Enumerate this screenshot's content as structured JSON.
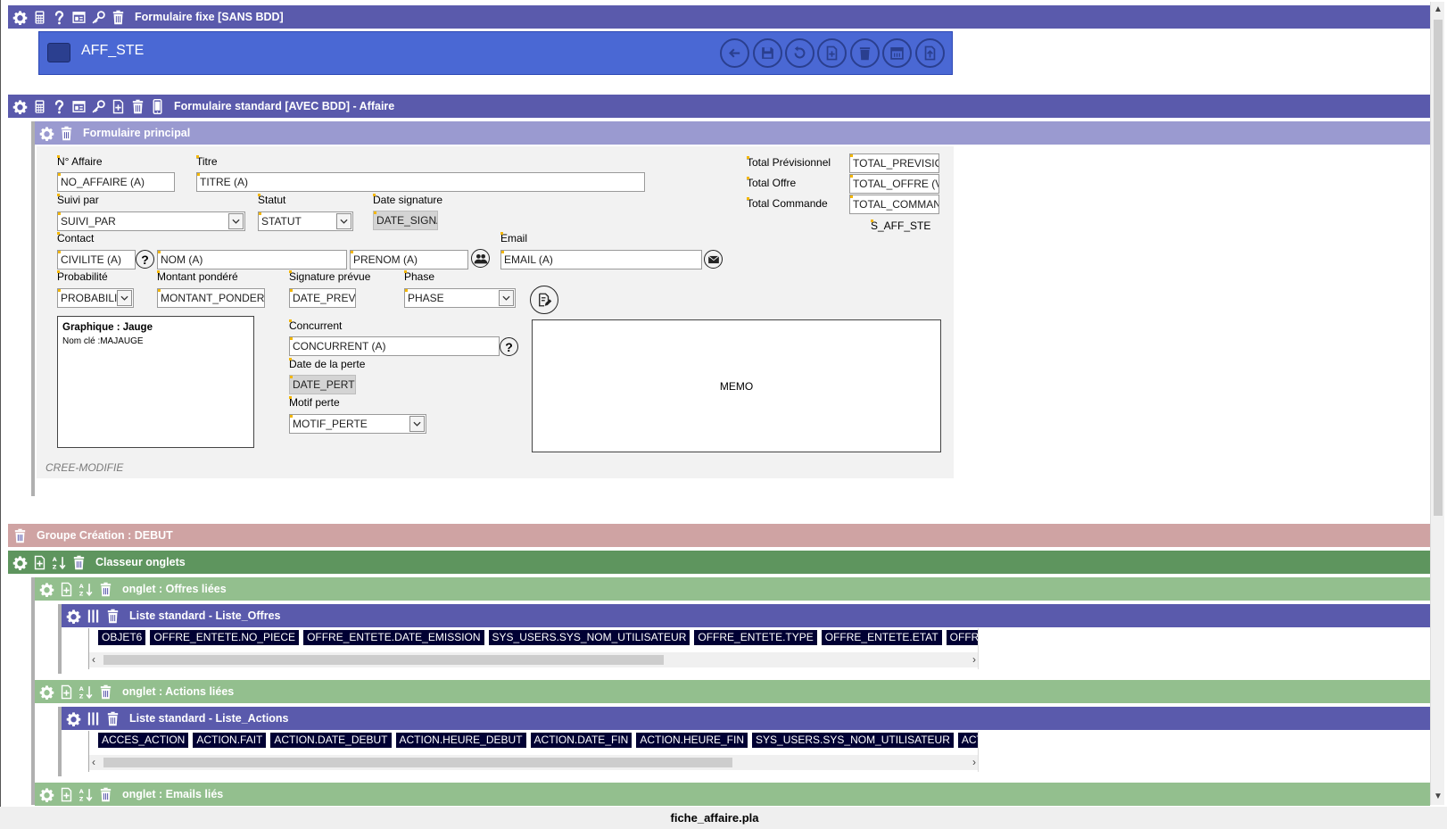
{
  "footer": {
    "filename": "fiche_affaire.pla"
  },
  "fixed_form": {
    "title": "Formulaire fixe [SANS BDD]",
    "name": "AFF_STE",
    "toolbar_icons": [
      "back-arrow-icon",
      "save-icon",
      "undo-icon",
      "new-document-icon",
      "delete-icon",
      "calendar-icon",
      "export-icon"
    ]
  },
  "standard_form": {
    "title": "Formulaire standard [AVEC BDD] - Affaire"
  },
  "main_form": {
    "title": "Formulaire principal",
    "labels": {
      "no_affaire": "N° Affaire",
      "titre": "Titre",
      "suivi_par": "Suivi par",
      "statut": "Statut",
      "date_signature": "Date signature",
      "contact": "Contact",
      "email": "Email",
      "probabilite": "Probabilité",
      "montant_pondere": "Montant pondéré",
      "signature_prevue": "Signature prévue",
      "phase": "Phase",
      "concurrent": "Concurrent",
      "date_perte": "Date de la perte",
      "motif_perte": "Motif perte",
      "total_previsionnel": "Total Prévisionnel",
      "total_offre": "Total Offre",
      "total_commande": "Total Commande"
    },
    "fields": {
      "no_affaire": "NO_AFFAIRE (A)",
      "titre": "TITRE (A)",
      "suivi_par": "SUIVI_PAR",
      "statut": "STATUT",
      "date_signature": "DATE_SIGNA",
      "civilite": "CIVILITE (A)",
      "nom": "NOM (A)",
      "prenom": "PRENOM (A)",
      "email": "EMAIL (A)",
      "probabilite": "PROBABILIT",
      "montant_pondere": "MONTANT_PONDER",
      "signature_prevue": "DATE_PREVI",
      "phase": "PHASE",
      "concurrent": "CONCURRENT (A)",
      "date_perte": "DATE_PERTI",
      "motif_perte": "MOTIF_PERTE",
      "total_previsionnel": "TOTAL_PREVISIO",
      "total_offre": "TOTAL_OFFRE (V",
      "total_commande": "TOTAL_COMMAN"
    },
    "s_aff_ste": "S_AFF_STE",
    "graph_title": "Graphique : Jauge",
    "graph_key": "Nom clé :MAJAUGE",
    "memo": "MEMO",
    "cree_modifie": "CREE-MODIFIE"
  },
  "groupe_creation": {
    "title": "Groupe Création : DEBUT"
  },
  "classeur": {
    "title": "Classeur onglets"
  },
  "tabs": [
    {
      "title": "onglet : Offres liées"
    },
    {
      "title": "onglet : Actions liées"
    },
    {
      "title": "onglet : Emails liés"
    }
  ],
  "lists": [
    {
      "title": "Liste standard - Liste_Offres",
      "columns": [
        "OBJET6",
        "OFFRE_ENTETE.NO_PIECE",
        "OFFRE_ENTETE.DATE_EMISSION",
        "SYS_USERS.SYS_NOM_UTILISATEUR",
        "OFFRE_ENTETE.TYPE",
        "OFFRE_ENTETE.ETAT",
        "OFFRE_EN"
      ],
      "scroll_fraction": 0.65
    },
    {
      "title": "Liste standard - Liste_Actions",
      "columns": [
        "ACCES_ACTION",
        "ACTION.FAIT",
        "ACTION.DATE_DEBUT",
        "ACTION.HEURE_DEBUT",
        "ACTION.DATE_FIN",
        "ACTION.HEURE_FIN",
        "SYS_USERS.SYS_NOM_UTILISATEUR",
        "ACTIC"
      ],
      "scroll_fraction": 0.73
    }
  ],
  "colors": {
    "blue_bar": "#5a5aac",
    "light_blue_bar": "#9a9ad0",
    "red_bar": "#cfa3a3",
    "green_bar": "#5e955e",
    "light_green_bar": "#93bf8e",
    "fixed_panel": "#4a68d4",
    "column_tag": "#000033"
  }
}
